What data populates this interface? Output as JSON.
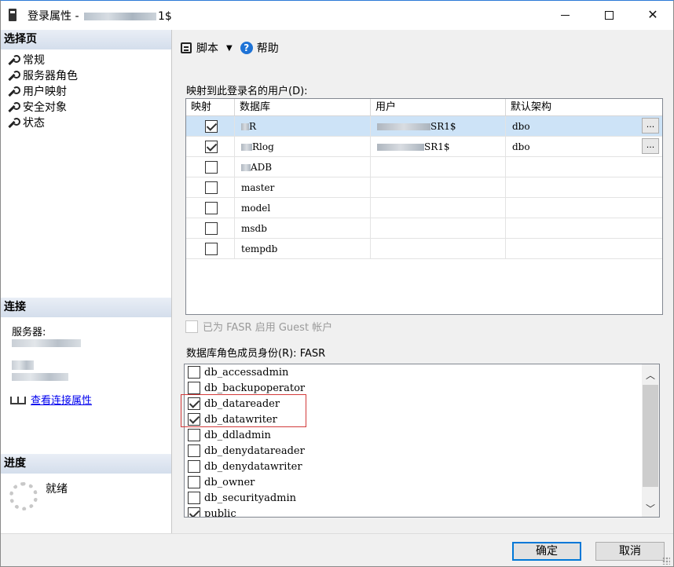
{
  "window": {
    "title_prefix": "登录属性 - ",
    "title_suffix": "1$"
  },
  "left": {
    "select_page_header": "选择页",
    "pages": [
      {
        "label": "常规"
      },
      {
        "label": "服务器角色"
      },
      {
        "label": "用户映射"
      },
      {
        "label": "安全对象"
      },
      {
        "label": "状态"
      }
    ],
    "connection_header": "连接",
    "server_label": "服务器:",
    "view_connection_props": "查看连接属性",
    "progress_header": "进度",
    "progress_status": "就绪"
  },
  "toolbar": {
    "script_label": "脚本",
    "help_label": "帮助"
  },
  "mapping": {
    "label": "映射到此登录名的用户(D):",
    "columns": [
      "映射",
      "数据库",
      "用户",
      "默认架构"
    ],
    "rows": [
      {
        "mapped": true,
        "db": "R",
        "user": "SR1$",
        "schema": "dbo",
        "selected": true,
        "has_button": true
      },
      {
        "mapped": true,
        "db": "Rlog",
        "user": "SR1$",
        "schema": "dbo",
        "selected": false,
        "has_button": true
      },
      {
        "mapped": false,
        "db": "ADB",
        "user": "",
        "schema": "",
        "selected": false,
        "has_button": false
      },
      {
        "mapped": false,
        "db": "master",
        "user": "",
        "schema": "",
        "selected": false,
        "has_button": false
      },
      {
        "mapped": false,
        "db": "model",
        "user": "",
        "schema": "",
        "selected": false,
        "has_button": false
      },
      {
        "mapped": false,
        "db": "msdb",
        "user": "",
        "schema": "",
        "selected": false,
        "has_button": false
      },
      {
        "mapped": false,
        "db": "tempdb",
        "user": "",
        "schema": "",
        "selected": false,
        "has_button": false
      }
    ],
    "ellipsis": "..."
  },
  "guest": {
    "label": "已为 FASR 启用 Guest 帐户",
    "enabled": false
  },
  "roles": {
    "label": "数据库角色成员身份(R): FASR",
    "items": [
      {
        "name": "db_accessadmin",
        "checked": false
      },
      {
        "name": "db_backupoperator",
        "checked": false
      },
      {
        "name": "db_datareader",
        "checked": true
      },
      {
        "name": "db_datawriter",
        "checked": true
      },
      {
        "name": "db_ddladmin",
        "checked": false
      },
      {
        "name": "db_denydatareader",
        "checked": false
      },
      {
        "name": "db_denydatawriter",
        "checked": false
      },
      {
        "name": "db_owner",
        "checked": false
      },
      {
        "name": "db_securityadmin",
        "checked": false
      },
      {
        "name": "public",
        "checked": true
      }
    ]
  },
  "buttons": {
    "ok": "确定",
    "cancel": "取消"
  },
  "icons": {
    "page": "wrench-icon",
    "script": "script-icon",
    "help": "help-icon",
    "connection": "plug-icon",
    "progress": "spinner-icon"
  },
  "colors": {
    "selected_row": "#cde3f7",
    "section_header": "#d4deec",
    "highlight_box": "#d23a3a",
    "ok_border": "#0078d7"
  }
}
